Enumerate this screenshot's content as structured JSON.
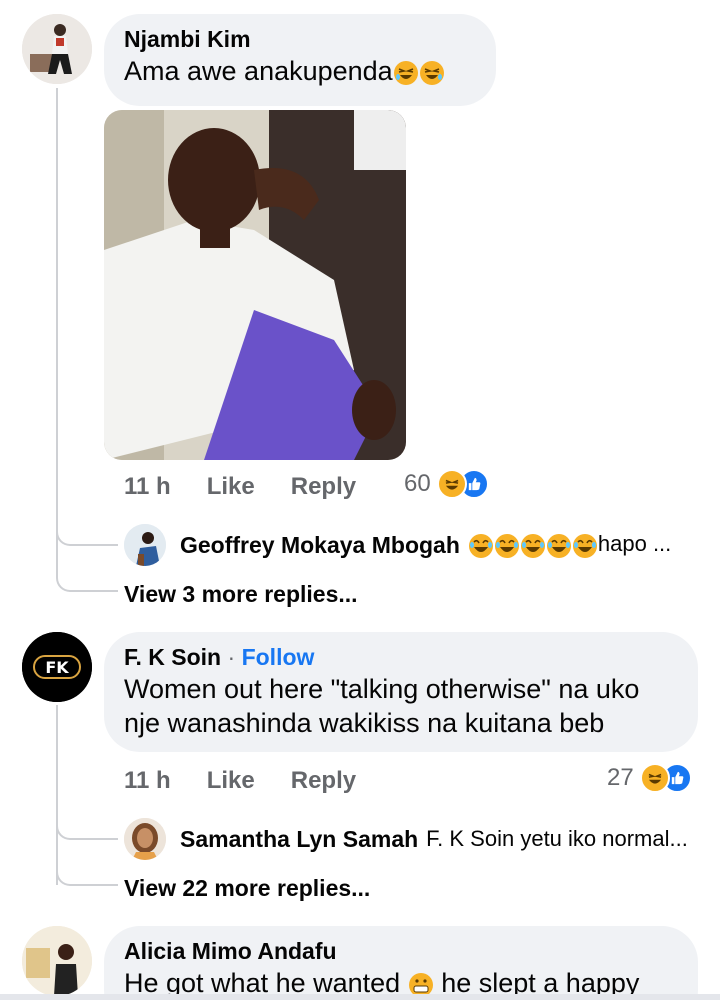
{
  "comments": [
    {
      "author": "Njambi Kim",
      "text": "Ama awe anakupenda",
      "time": "11 h",
      "like_label": "Like",
      "reply_label": "Reply",
      "reaction_count": "60",
      "reactions": [
        "haha-icon",
        "like-icon"
      ],
      "reply_preview": {
        "author": "Geoffrey Mokaya Mbogah",
        "text": "hapo ..."
      },
      "view_more": "View 3 more replies..."
    },
    {
      "author": "F. K Soin",
      "follow_sep": "·",
      "follow_label": "Follow",
      "text": "Women out here \"talking otherwise\" na uko nje wanashinda wakikiss na kuitana beb",
      "time": "11 h",
      "like_label": "Like",
      "reply_label": "Reply",
      "reaction_count": "27",
      "reactions": [
        "haha-icon",
        "like-icon"
      ],
      "reply_preview": {
        "author": "Samantha Lyn Samah",
        "text": "F. K Soin yetu iko normal..."
      },
      "view_more": "View 22 more replies..."
    },
    {
      "author": "Alicia Mimo Andafu",
      "text_part1": "He got what he wanted",
      "text_part2": "he slept a happy"
    }
  ],
  "avatar_text": {
    "fk": "FK"
  },
  "colors": {
    "bubble": "#f0f2f5",
    "link": "#1877f2",
    "meta": "#65676b",
    "thread": "#ced0d4",
    "haha": "#f7b125"
  }
}
